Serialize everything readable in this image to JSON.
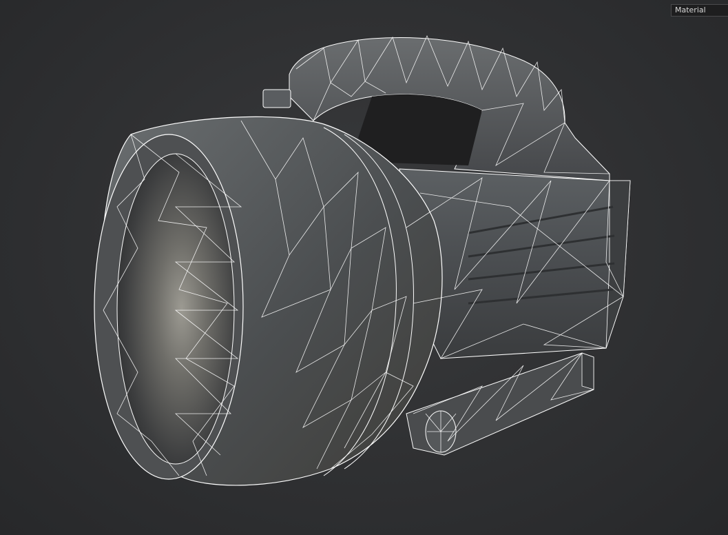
{
  "viewport": {
    "render_mode": "wireframe-on-shaded",
    "subject": "flashlight-3d-model",
    "background_color": "#2f3032",
    "wire_color": "#ffffff",
    "shade_color": "#55585a"
  },
  "material_dropdown": {
    "selected": "Material"
  }
}
